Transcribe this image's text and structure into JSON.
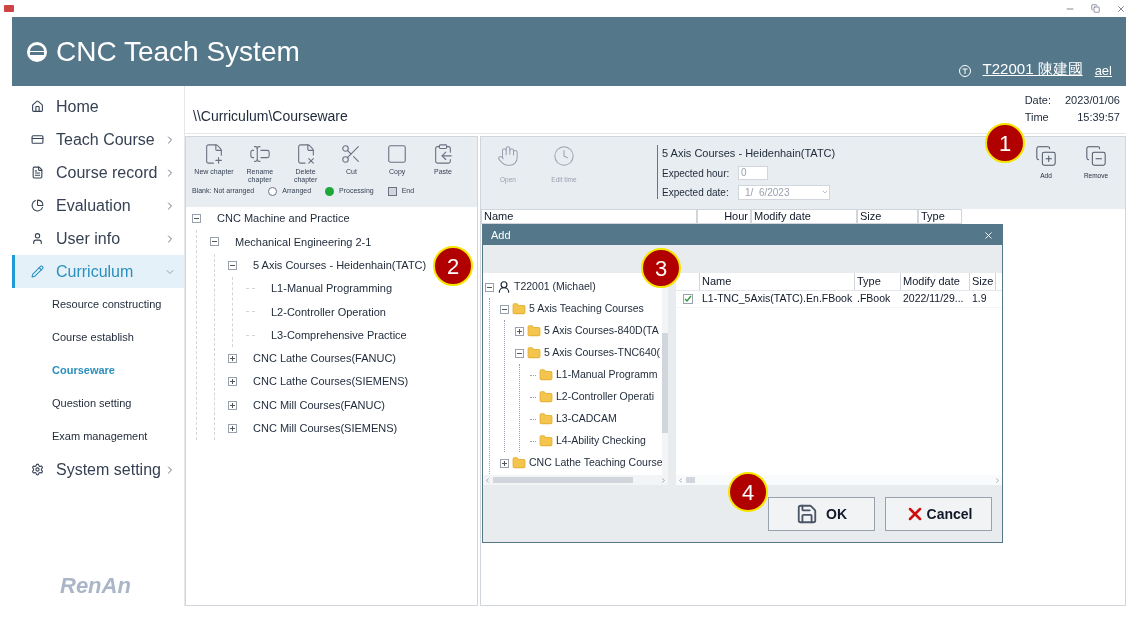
{
  "header": {
    "title": "CNC Teach System",
    "user_id": "T22001 陳建國",
    "user_name_fragment": "ael"
  },
  "sidebar": {
    "items": [
      {
        "label": "Home",
        "has_arrow": false,
        "selected": false
      },
      {
        "label": "Teach Course",
        "has_arrow": true,
        "expanded": false,
        "selected": false
      },
      {
        "label": "Course record",
        "has_arrow": true,
        "expanded": false,
        "selected": false
      },
      {
        "label": "Evaluation",
        "has_arrow": true,
        "expanded": false,
        "selected": false
      },
      {
        "label": "User info",
        "has_arrow": true,
        "expanded": false,
        "selected": false
      },
      {
        "label": "Curriculum",
        "has_arrow": true,
        "expanded": true,
        "selected": true,
        "children": [
          {
            "label": "Resource constructing",
            "selected": false
          },
          {
            "label": "Course establish",
            "selected": false
          },
          {
            "label": "Courseware",
            "selected": true
          },
          {
            "label": "Question setting",
            "selected": false
          },
          {
            "label": "Exam management",
            "selected": false
          }
        ]
      },
      {
        "label": "System setting",
        "has_arrow": true,
        "expanded": false,
        "selected": false
      }
    ],
    "logo": "RenAn"
  },
  "breadcrumb": "\\\\Curriculum\\Courseware",
  "datetime": {
    "date_label": "Date:",
    "date": "2023/01/06",
    "time_label": "Time",
    "time": "15:39:57"
  },
  "chapter_toolbar": {
    "buttons": [
      "New chapter",
      "Rename chapter",
      "Delete chapter",
      "Cut",
      "Copy",
      "Paste"
    ],
    "legend_note": "Blank: Not arranged",
    "legend": [
      {
        "label": "Arranged",
        "kind": "arranged"
      },
      {
        "label": "Processing",
        "kind": "processing"
      },
      {
        "label": "End",
        "kind": "end"
      }
    ]
  },
  "course_tree": [
    {
      "label": "CNC Machine and Practice",
      "expanded": true,
      "children": [
        {
          "label": "Mechanical Engineering 2-1",
          "expanded": true,
          "children": [
            {
              "label": "5 Axis Courses - Heidenhain(TATC)",
              "expanded": true,
              "children": [
                {
                  "label": "L1-Manual Programming"
                },
                {
                  "label": "L2-Controller Operation"
                },
                {
                  "label": "L3-Comprehensive Practice"
                }
              ]
            },
            {
              "label": "CNC Lathe Courses(FANUC)",
              "expanded": false
            },
            {
              "label": "CNC Lathe Courses(SIEMENS)",
              "expanded": false
            },
            {
              "label": "CNC Mill Courses(FANUC)",
              "expanded": false
            },
            {
              "label": "CNC Mill Courses(SIEMENS)",
              "expanded": false
            }
          ]
        }
      ]
    }
  ],
  "courseware_toolbar": {
    "buttons": [
      {
        "label": "Open",
        "disabled": true
      },
      {
        "label": "Edit time",
        "disabled": true
      }
    ],
    "course_title": "5 Axis Courses - Heidenhain(TATC)",
    "hour_label": "Expected hour:",
    "hour_value": "0",
    "date_label": "Expected date:",
    "date_value": "1/  6/2023",
    "actions": [
      "Add",
      "Remove"
    ]
  },
  "courseware_table": {
    "columns": [
      "Name",
      "Hour",
      "Modify date",
      "Size",
      "Type"
    ]
  },
  "dialog": {
    "title": "Add",
    "tree": [
      {
        "label": "T22001 (Michael)",
        "kind": "user",
        "expanded": true,
        "children": [
          {
            "label": "5 Axis Teaching Courses",
            "kind": "folder",
            "expanded": true,
            "children": [
              {
                "label": "5 Axis Courses-840D(TA",
                "kind": "folder",
                "expanded": false
              },
              {
                "label": "5 Axis Courses-TNC640(",
                "kind": "folder",
                "expanded": true,
                "children": [
                  {
                    "label": "L1-Manual Programm",
                    "kind": "folder"
                  },
                  {
                    "label": "L2-Controller Operati",
                    "kind": "folder"
                  },
                  {
                    "label": "L3-CADCAM",
                    "kind": "folder"
                  },
                  {
                    "label": "L4-Ability Checking",
                    "kind": "folder"
                  }
                ]
              }
            ]
          },
          {
            "label": "CNC Lathe Teaching Course",
            "kind": "folder",
            "expanded": false
          }
        ]
      }
    ],
    "columns": [
      "Name",
      "Type",
      "Modify date",
      "Size"
    ],
    "rows": [
      {
        "checked": true,
        "cells": [
          "L1-TNC_5Axis(TATC).En.FBook",
          ".FBook",
          "2022/11/29...",
          "1.9"
        ]
      }
    ],
    "ok": "OK",
    "cancel": "Cancel"
  },
  "annotations": [
    "1",
    "2",
    "3",
    "4"
  ]
}
